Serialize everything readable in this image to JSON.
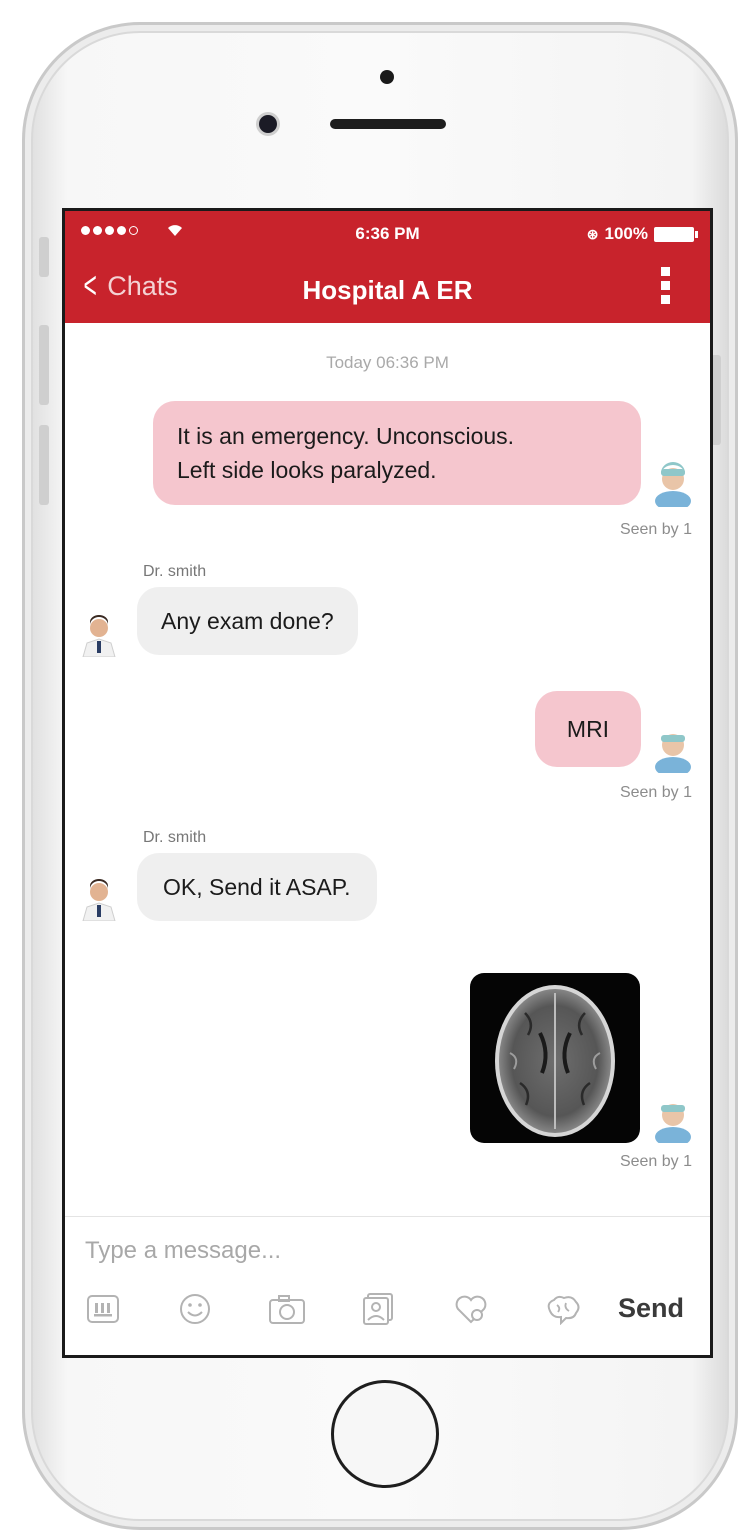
{
  "status_bar": {
    "time": "6:36 PM",
    "battery": "100%"
  },
  "header": {
    "back_label": "Chats",
    "title": "Hospital A ER"
  },
  "chat": {
    "date_separator": "Today 06:36 PM",
    "messages": [
      {
        "direction": "outgoing",
        "lines": [
          "It is an emergency. Unconscious.",
          "Left side looks paralyzed."
        ],
        "seen": "Seen by 1"
      },
      {
        "direction": "incoming",
        "sender": "Dr. smith",
        "text": "Any exam done?"
      },
      {
        "direction": "outgoing",
        "text": "MRI",
        "seen": "Seen by 1"
      },
      {
        "direction": "incoming",
        "sender": "Dr. smith",
        "text": "OK, Send it ASAP."
      },
      {
        "direction": "outgoing",
        "type": "image",
        "image": "brain-mri-scan",
        "seen": "Seen by 1"
      }
    ]
  },
  "composer": {
    "placeholder": "Type a message...",
    "send_label": "Send",
    "tools": [
      "keyboard-icon",
      "emoji-icon",
      "camera-icon",
      "gallery-icon",
      "heart-icon",
      "brain-icon"
    ]
  },
  "colors": {
    "accent": "#c8232c",
    "outgoing_bubble": "#f5c6ce",
    "incoming_bubble": "#efefef"
  }
}
